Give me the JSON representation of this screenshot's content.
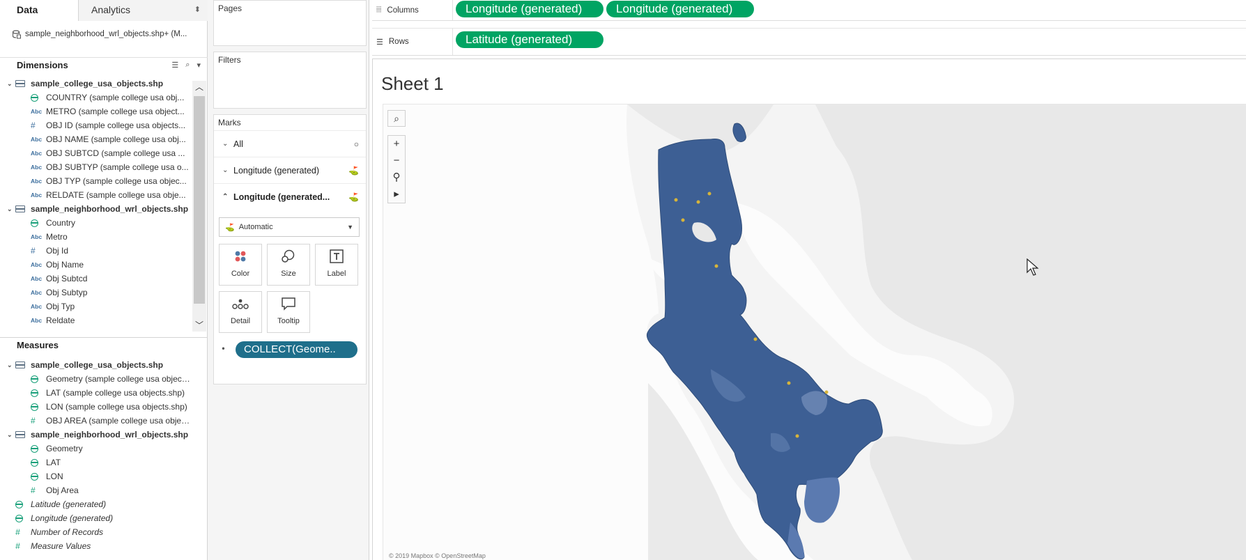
{
  "data_pane": {
    "tabs": [
      {
        "label": "Data"
      },
      {
        "label": "Analytics"
      }
    ],
    "datasource_label": "sample_neighborhood_wrl_objects.shp+ (M...",
    "dimensions_title": "Dimensions",
    "dimensions": [
      {
        "kind": "table",
        "label": "sample_college_usa_objects.shp"
      },
      {
        "kind": "field",
        "icon": "globe",
        "label": "COUNTRY (sample college usa obj..."
      },
      {
        "kind": "field",
        "icon": "abc",
        "label": "METRO (sample college usa object..."
      },
      {
        "kind": "field",
        "icon": "hash-d",
        "label": "OBJ ID (sample college usa objects..."
      },
      {
        "kind": "field",
        "icon": "abc",
        "label": "OBJ NAME (sample college usa obj..."
      },
      {
        "kind": "field",
        "icon": "abc",
        "label": "OBJ SUBTCD (sample college usa ..."
      },
      {
        "kind": "field",
        "icon": "abc",
        "label": "OBJ SUBTYP (sample college usa o..."
      },
      {
        "kind": "field",
        "icon": "abc",
        "label": "OBJ TYP (sample college usa objec..."
      },
      {
        "kind": "field",
        "icon": "abc",
        "label": "RELDATE (sample college usa obje..."
      },
      {
        "kind": "table",
        "label": "sample_neighborhood_wrl_objects.shp"
      },
      {
        "kind": "field",
        "icon": "globe",
        "label": "Country"
      },
      {
        "kind": "field",
        "icon": "abc",
        "label": "Metro"
      },
      {
        "kind": "field",
        "icon": "hash-d",
        "label": "Obj Id"
      },
      {
        "kind": "field",
        "icon": "abc",
        "label": "Obj Name"
      },
      {
        "kind": "field",
        "icon": "abc",
        "label": "Obj Subtcd"
      },
      {
        "kind": "field",
        "icon": "abc",
        "label": "Obj Subtyp"
      },
      {
        "kind": "field",
        "icon": "abc",
        "label": "Obj Typ"
      },
      {
        "kind": "field",
        "icon": "abc",
        "label": "Reldate"
      }
    ],
    "measures_title": "Measures",
    "measures": [
      {
        "kind": "table",
        "label": "sample_college_usa_objects.shp"
      },
      {
        "kind": "field",
        "icon": "globe",
        "label": "Geometry (sample college usa objects.s..."
      },
      {
        "kind": "field",
        "icon": "globe",
        "label": "LAT (sample college usa objects.shp)"
      },
      {
        "kind": "field",
        "icon": "globe",
        "label": "LON (sample college usa objects.shp)"
      },
      {
        "kind": "field",
        "icon": "hash",
        "label": "OBJ AREA (sample college usa objects..."
      },
      {
        "kind": "table",
        "label": "sample_neighborhood_wrl_objects.shp"
      },
      {
        "kind": "field",
        "icon": "globe",
        "label": "Geometry"
      },
      {
        "kind": "field",
        "icon": "globe",
        "label": "LAT"
      },
      {
        "kind": "field",
        "icon": "globe",
        "label": "LON"
      },
      {
        "kind": "field",
        "icon": "hash",
        "label": "Obj Area"
      },
      {
        "kind": "top",
        "icon": "globe",
        "label": "Latitude (generated)"
      },
      {
        "kind": "top",
        "icon": "globe",
        "label": "Longitude (generated)"
      },
      {
        "kind": "top",
        "icon": "hash",
        "label": "Number of Records"
      },
      {
        "kind": "top",
        "icon": "hash",
        "label": "Measure Values"
      }
    ]
  },
  "shelves": {
    "pages_label": "Pages",
    "filters_label": "Filters",
    "marks_label": "Marks",
    "marks_rows": [
      {
        "label": "All",
        "caret": "⌄"
      },
      {
        "label": "Longitude (generated)",
        "caret": "⌄"
      },
      {
        "label": "Longitude (generated...",
        "caret": "⌃"
      }
    ],
    "mark_type": "Automatic",
    "mark_buttons": [
      {
        "label": "Color"
      },
      {
        "label": "Size"
      },
      {
        "label": "Label"
      },
      {
        "label": "Detail"
      },
      {
        "label": "Tooltip"
      }
    ],
    "collect_pill": "COLLECT(Geome.."
  },
  "columns_label": "Columns",
  "rows_label": "Rows",
  "columns_pills": [
    "Longitude (generated)",
    "Longitude (generated)"
  ],
  "rows_pills": [
    "Latitude (generated)"
  ],
  "sheet": {
    "title": "Sheet 1",
    "attribution": "© 2019 Mapbox © OpenStreetMap"
  },
  "colors": {
    "pill_green": "#00a463",
    "pill_blue": "#1f6f8b",
    "region_fill": "#3d5f94",
    "highlight": "#d6b43a"
  }
}
